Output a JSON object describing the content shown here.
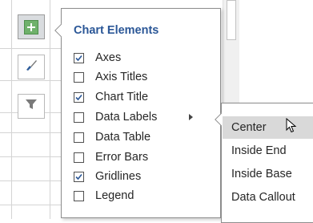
{
  "chart_elements": {
    "title": "Chart Elements",
    "items": [
      {
        "label": "Axes",
        "checked": true
      },
      {
        "label": "Axis Titles",
        "checked": false
      },
      {
        "label": "Chart Title",
        "checked": true
      },
      {
        "label": "Data Labels",
        "checked": false,
        "has_submenu": true
      },
      {
        "label": "Data Table",
        "checked": false
      },
      {
        "label": "Error Bars",
        "checked": false
      },
      {
        "label": "Gridlines",
        "checked": true
      },
      {
        "label": "Legend",
        "checked": false
      }
    ]
  },
  "data_labels_submenu": {
    "items": [
      {
        "label": "Center",
        "hovered": true
      },
      {
        "label": "Inside End"
      },
      {
        "label": "Inside Base"
      },
      {
        "label": "Data Callout"
      }
    ]
  },
  "tool_buttons": [
    {
      "name": "chart-elements-button",
      "icon": "plus-icon",
      "active": true
    },
    {
      "name": "chart-styles-button",
      "icon": "paintbrush-icon",
      "active": false
    },
    {
      "name": "chart-filters-button",
      "icon": "filter-icon",
      "active": false
    }
  ],
  "colors": {
    "title": "#2b5797",
    "plus": "#6fb16b",
    "hover": "#d9d9d9"
  }
}
